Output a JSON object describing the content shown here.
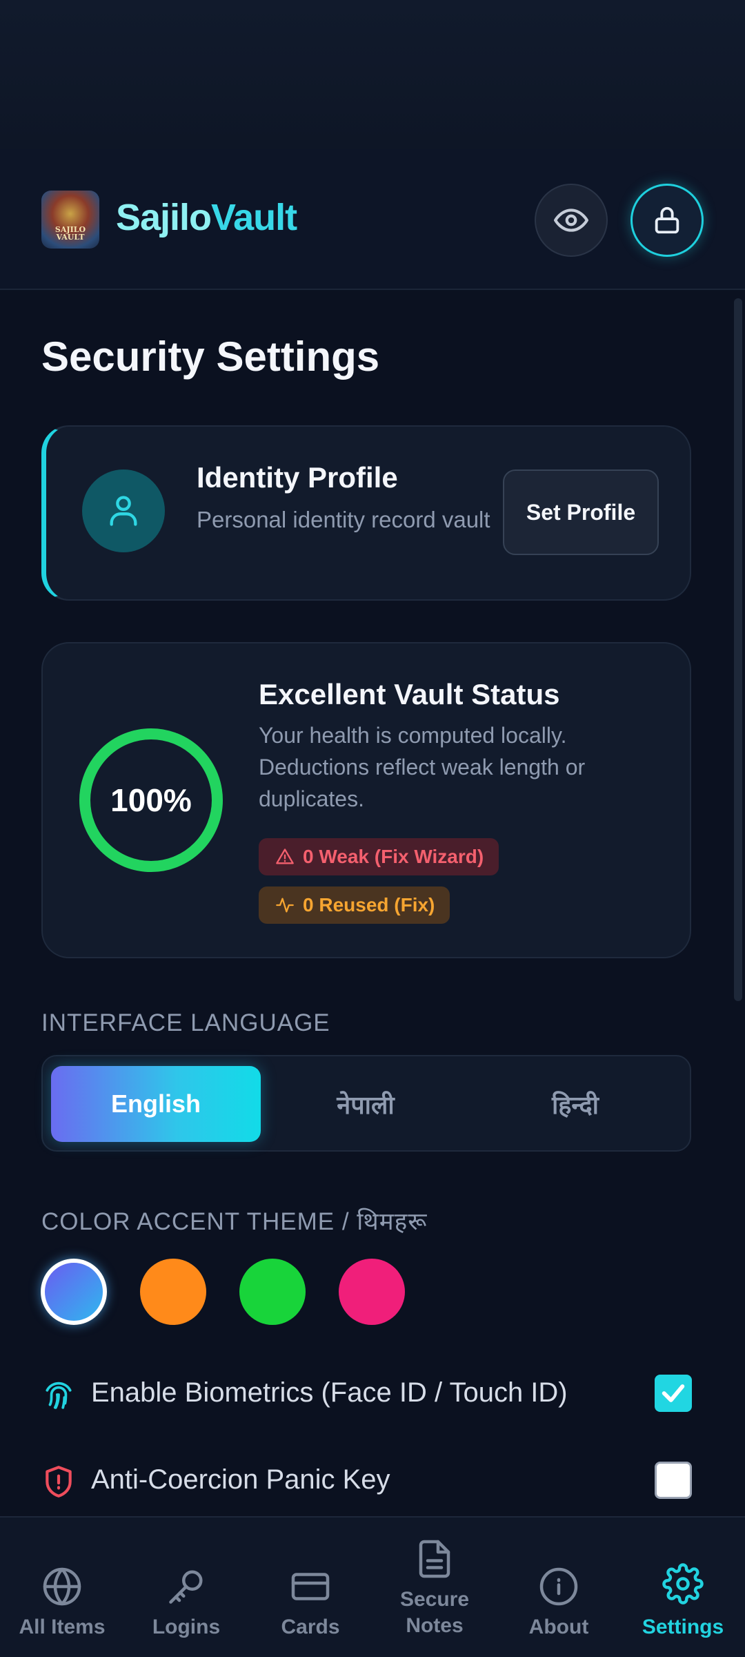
{
  "app": {
    "title_part1": "Sajilo",
    "title_part2": "Vault",
    "logo_text": "SAJILO VAULT"
  },
  "header": {
    "eye_icon": "eye-icon",
    "lock_icon": "lock-icon"
  },
  "page": {
    "title": "Security Settings"
  },
  "identity": {
    "title": "Identity Profile",
    "subtitle": "Personal identity record vault",
    "button_label": "Set Profile",
    "icon": "user-icon"
  },
  "health": {
    "percent_label": "100%",
    "percent_value": 100,
    "title": "Excellent Vault Status",
    "description": "Your health is computed locally. Deductions reflect weak length or duplicates.",
    "weak_label": "0 Weak (Fix Wizard)",
    "reused_label": "0 Reused (Fix)",
    "colors": {
      "ring": "#22d45f",
      "weak": "#f4606e",
      "reused": "#f6a531"
    }
  },
  "language": {
    "section_label": "INTERFACE LANGUAGE",
    "options": [
      "English",
      "नेपाली",
      "हिन्दी"
    ],
    "selected": "English"
  },
  "theme": {
    "section_label": "COLOR ACCENT THEME / थिमहरू",
    "swatches": [
      {
        "name": "blue-cyan",
        "color": "#4a7bf0",
        "selected": true
      },
      {
        "name": "orange",
        "color": "#ff8a1a",
        "selected": false
      },
      {
        "name": "green",
        "color": "#18d43a",
        "selected": false
      },
      {
        "name": "pink",
        "color": "#f01f7a",
        "selected": false
      }
    ]
  },
  "toggles": {
    "biometrics": {
      "label": "Enable Biometrics (Face ID / Touch ID)",
      "checked": true,
      "icon": "fingerprint-icon"
    },
    "panic": {
      "label": "Anti-Coercion Panic Key",
      "checked": false,
      "icon": "shield-alert-icon"
    }
  },
  "nav": {
    "items": [
      {
        "label": "All Items",
        "icon": "globe-icon"
      },
      {
        "label": "Logins",
        "icon": "key-icon"
      },
      {
        "label": "Cards",
        "icon": "credit-card-icon"
      },
      {
        "label": "Secure Notes",
        "icon": "document-icon"
      },
      {
        "label": "About",
        "icon": "info-icon"
      },
      {
        "label": "Settings",
        "icon": "gear-icon"
      }
    ],
    "active": "Settings",
    "active_color": "#22d3e0"
  }
}
